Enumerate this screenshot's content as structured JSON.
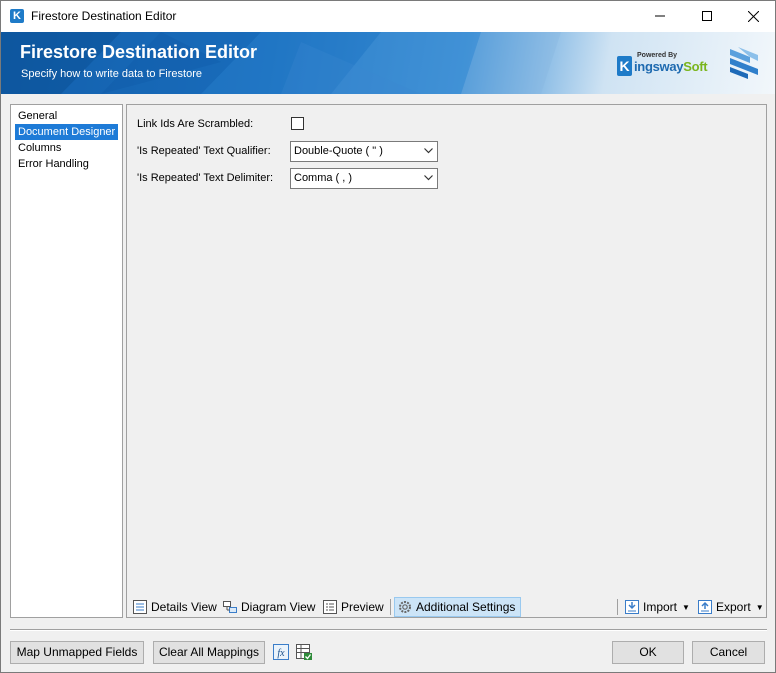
{
  "window": {
    "title": "Firestore Destination Editor"
  },
  "banner": {
    "title": "Firestore Destination Editor",
    "subtitle": "Specify how to write data to Firestore",
    "brand_powered": "Powered By",
    "brand_name_main": "ingsway",
    "brand_name_accent": "Soft",
    "brand_letter": "K"
  },
  "nav": {
    "items": [
      {
        "label": "General",
        "selected": false
      },
      {
        "label": "Document Designer",
        "selected": true
      },
      {
        "label": "Columns",
        "selected": false
      },
      {
        "label": "Error Handling",
        "selected": false
      }
    ]
  },
  "form": {
    "link_ids_label": "Link Ids Are Scrambled:",
    "link_ids_checked": false,
    "qualifier_label": "'Is Repeated' Text Qualifier:",
    "qualifier_value": "Double-Quote ( \" )",
    "delimiter_label": "'Is Repeated' Text Delimiter:",
    "delimiter_value": "Comma ( , )"
  },
  "toolbar": {
    "details_view": "Details View",
    "diagram_view": "Diagram View",
    "preview": "Preview",
    "additional_settings": "Additional Settings",
    "import": "Import",
    "export": "Export"
  },
  "footer": {
    "map_unmapped": "Map Unmapped Fields",
    "clear_mappings": "Clear All Mappings",
    "fx_label": "fx",
    "ok": "OK",
    "cancel": "Cancel"
  },
  "colors": {
    "accent_blue": "#1e7bd7",
    "banner_blue": "#1a72c2",
    "brand_green": "#7ab51d",
    "active_tab_bg": "#cce4f7"
  },
  "icons": {
    "app": "kingswaysoft-k-icon",
    "minimize": "minimize-icon",
    "maximize": "maximize-icon",
    "close": "close-icon",
    "details": "details-view-icon",
    "diagram": "diagram-view-icon",
    "preview": "preview-icon",
    "settings": "gear-icon",
    "import": "import-icon",
    "export": "export-icon",
    "fx": "expression-icon",
    "excel": "spreadsheet-icon"
  }
}
